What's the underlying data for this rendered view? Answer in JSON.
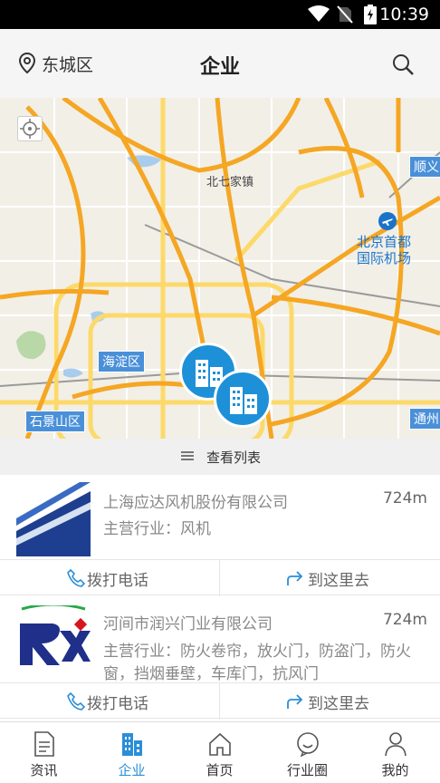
{
  "status_bar": {
    "time": "10:39"
  },
  "header": {
    "location": "东城区",
    "title": "企业"
  },
  "map": {
    "labels": {
      "beiqijia": "北七家镇",
      "airport_line1": "北京首都",
      "airport_line2": "国际机场",
      "haidian": "海淀区",
      "shijingshan": "石景山区",
      "shunyi": "顺义",
      "tongzhou": "通州"
    },
    "marker_count": 2
  },
  "list_toggle": {
    "label": "查看列表"
  },
  "companies": [
    {
      "name": "上海应达风机股份有限公司",
      "distance": "724m",
      "industry": "主营行业：风机",
      "call_label": "拨打电话",
      "nav_label": "到这里去"
    },
    {
      "name": "河间市润兴门业有限公司",
      "distance": "724m",
      "industry": "主营行业：防火卷帘，放火门，防盗门，防火窗，挡烟垂壁，车库门，抗风门",
      "call_label": "拨打电话",
      "nav_label": "到这里去"
    }
  ],
  "bottom_nav": {
    "tabs": [
      {
        "label": "资讯",
        "icon": "document-icon",
        "active": false
      },
      {
        "label": "企业",
        "icon": "building-icon",
        "active": true
      },
      {
        "label": "首页",
        "icon": "home-icon",
        "active": false
      },
      {
        "label": "行业圈",
        "icon": "chat-bubble-icon",
        "active": false
      },
      {
        "label": "我的",
        "icon": "person-icon",
        "active": false
      }
    ]
  },
  "colors": {
    "accent": "#2b8ed8",
    "marker": "#1e90d8",
    "road_major": "#f5a623",
    "road_minor": "#fcd96a"
  }
}
